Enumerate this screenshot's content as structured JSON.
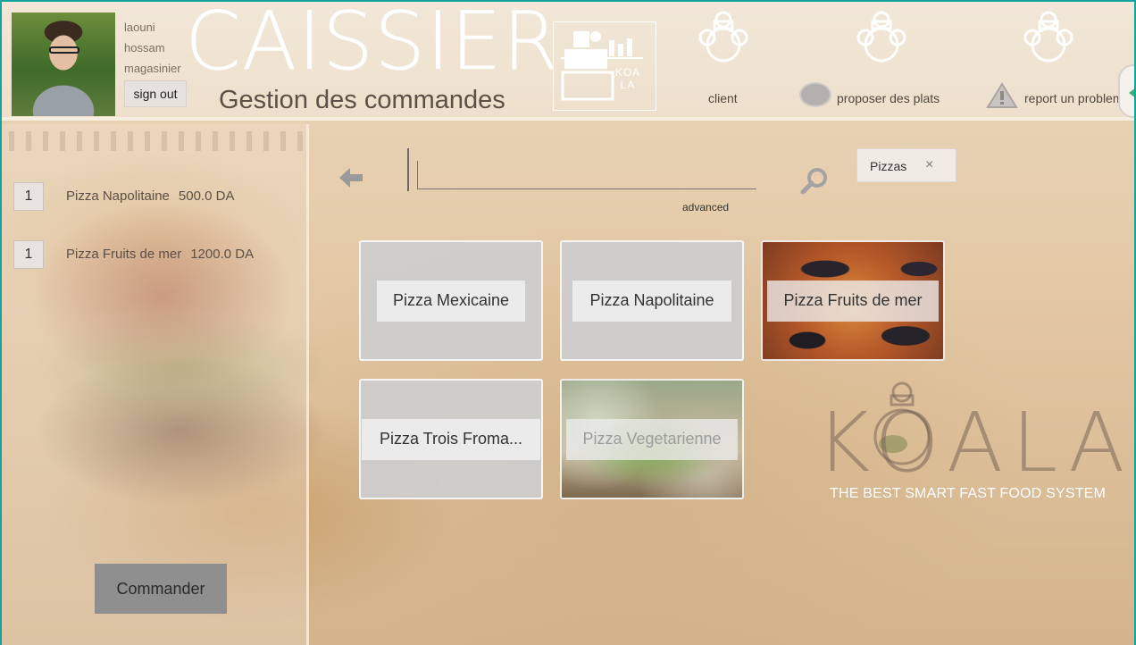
{
  "user": {
    "first_name": "laouni",
    "last_name": "hossam",
    "role": "magasinier",
    "signout_label": "sign out"
  },
  "app": {
    "title": "CAISSIER",
    "subtitle": "Gestion des commandes",
    "logo_text_line1": "KOA",
    "logo_text_line2": "LA"
  },
  "nav": {
    "items": [
      {
        "label": "client",
        "icon": "chef-koala-icon"
      },
      {
        "label": "proposer des plats",
        "icon": "plate-icon"
      },
      {
        "label": "report un problem",
        "icon": "warning-icon"
      }
    ]
  },
  "order": {
    "items": [
      {
        "qty": "1",
        "name": "Pizza Napolitaine",
        "price": "500.0 DA"
      },
      {
        "qty": "1",
        "name": "Pizza Fruits de mer",
        "price": "1200.0 DA"
      }
    ],
    "submit_label": "Commander"
  },
  "search": {
    "value": "",
    "advanced_label": "advanced"
  },
  "filter_chip": {
    "label": "Pizzas",
    "close_glyph": "×"
  },
  "menu": {
    "tiles": [
      {
        "label": "Pizza Mexicaine"
      },
      {
        "label": "Pizza Napolitaine"
      },
      {
        "label": "Pizza Fruits de mer"
      },
      {
        "label": "Pizza Trois Froma..."
      },
      {
        "label": "Pizza Vegetarienne"
      }
    ]
  },
  "brand": {
    "name": "KOALA",
    "tagline": "THE BEST SMART FAST FOOD SYSTEM"
  },
  "colors": {
    "window_border": "#14a4a0",
    "button_gray": "#8f8f8f",
    "tile_gray": "#cdcdcd"
  }
}
